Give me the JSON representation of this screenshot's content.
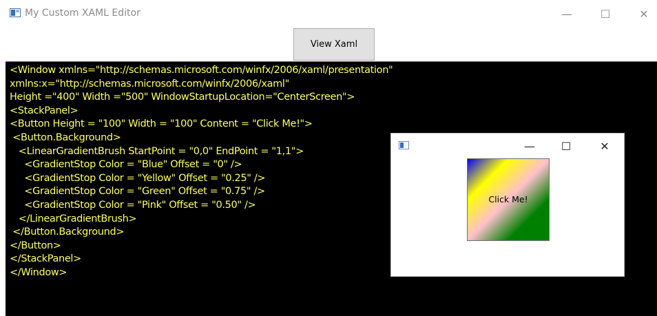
{
  "window": {
    "title": "My Custom XAML Editor",
    "controls": {
      "minimize": "—",
      "maximize": "☐",
      "close": "✕"
    }
  },
  "toolbar": {
    "view_xaml_label": "View Xaml"
  },
  "editor": {
    "background": "#000000",
    "text_color": "#ffff60",
    "lines": [
      "<Window xmlns=\"http://schemas.microsoft.com/winfx/2006/xaml/presentation\"",
      "xmlns:x=\"http://schemas.microsoft.com/winfx/2006/xaml\"",
      "Height =\"400\" Width =\"500\" WindowStartupLocation=\"CenterScreen\">",
      "<StackPanel>",
      "<Button Height = \"100\" Width = \"100\" Content = \"Click Me!\">",
      " <Button.Background>",
      "   <LinearGradientBrush StartPoint = \"0,0\" EndPoint = \"1,1\">",
      "     <GradientStop Color = \"Blue\" Offset = \"0\" />",
      "     <GradientStop Color = \"Yellow\" Offset = \"0.25\" />",
      "     <GradientStop Color = \"Green\" Offset = \"0.75\" />",
      "     <GradientStop Color = \"Pink\" Offset = \"0.50\" />",
      "   </LinearGradientBrush>",
      " </Button.Background>",
      "</Button>",
      "</StackPanel>",
      "</Window>"
    ]
  },
  "preview": {
    "controls": {
      "minimize": "—",
      "maximize": "☐",
      "close": "✕"
    },
    "button_label": "Click Me!",
    "gradient_colors": [
      "#0000ff",
      "#ffff00",
      "#ffc0cb",
      "#008000"
    ]
  }
}
